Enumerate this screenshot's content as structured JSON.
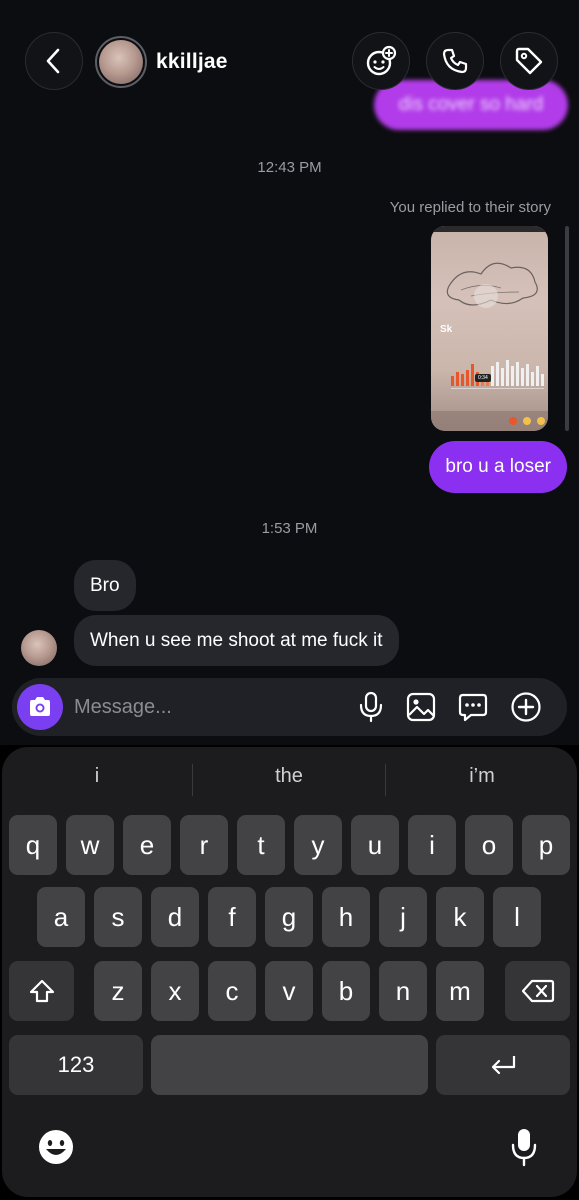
{
  "header": {
    "username": "kkilljae"
  },
  "conversation": {
    "blurred_message": "dis cover so hard",
    "timestamp_1": "12:43 PM",
    "story_reply_label": "You replied to their story",
    "story_overlay_text": "Sk",
    "story_time_text": "0:34",
    "outgoing_message": "bro u a loser",
    "timestamp_2": "1:53 PM",
    "incoming_messages": [
      "Bro",
      "When u see me shoot at me fuck it"
    ]
  },
  "composer": {
    "placeholder": "Message..."
  },
  "keyboard": {
    "suggestions": [
      "i",
      "the",
      "i’m"
    ],
    "row1": [
      "q",
      "w",
      "e",
      "r",
      "t",
      "y",
      "u",
      "i",
      "o",
      "p"
    ],
    "row2": [
      "a",
      "s",
      "d",
      "f",
      "g",
      "h",
      "j",
      "k",
      "l"
    ],
    "row3": [
      "z",
      "x",
      "c",
      "v",
      "b",
      "n",
      "m"
    ],
    "numbers_label": "123"
  },
  "colors": {
    "outgoing_bubble": "#8b2ff0",
    "camera_button": "#7b3ff2",
    "incoming_bubble": "#25272d",
    "keyboard_bg": "#1c1c1e",
    "key_bg": "#434346"
  },
  "icons": {
    "back": "chevron-left-icon",
    "effects": "face-effects-icon",
    "call": "phone-icon",
    "tag": "tag-icon",
    "camera": "camera-icon",
    "voice": "microphone-icon",
    "gallery": "image-icon",
    "sticker": "chat-bubble-icon",
    "more": "plus-circle-icon",
    "shift": "shift-arrow-icon",
    "delete": "backspace-icon",
    "return": "return-icon",
    "emoji": "emoji-icon",
    "dictation": "microphone-icon"
  }
}
